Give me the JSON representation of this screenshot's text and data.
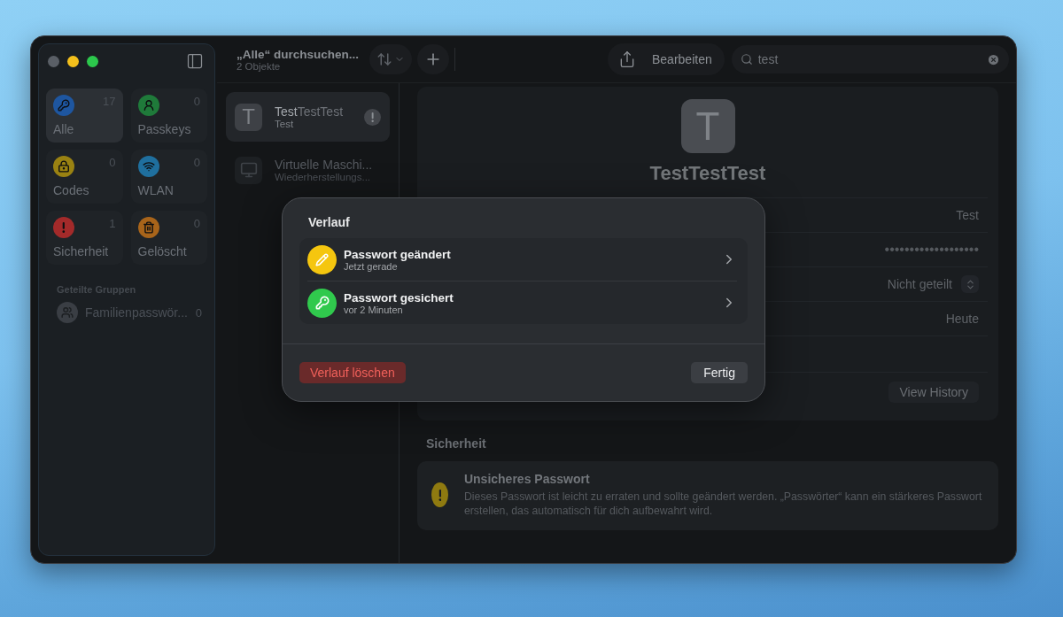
{
  "sidebar": {
    "categories": [
      {
        "label": "Alle",
        "count": "17",
        "kind": "key",
        "color": "#1e56a0",
        "selected": true
      },
      {
        "label": "Passkeys",
        "count": "0",
        "kind": "person",
        "color": "#1f7a3a",
        "selected": false
      },
      {
        "label": "Codes",
        "count": "0",
        "kind": "lock",
        "color": "#9a8212",
        "selected": false
      },
      {
        "label": "WLAN",
        "count": "0",
        "kind": "wifi",
        "color": "#1f6f9e",
        "selected": false
      },
      {
        "label": "Sicherheit",
        "count": "1",
        "kind": "alert",
        "color": "#a32a2a",
        "selected": false
      },
      {
        "label": "Gelöscht",
        "count": "0",
        "kind": "trash",
        "color": "#a8641a",
        "selected": false
      }
    ],
    "section_title": "Geteilte Gruppen",
    "groups": [
      {
        "label": "Familienpasswör...",
        "count": "0"
      }
    ]
  },
  "list": {
    "title": "„Alle“ durchsuchen...",
    "subtitle": "2 Objekte",
    "items": [
      {
        "title": "**Test**TestTest",
        "subtitle": "Test",
        "kind": "letter",
        "letter": "T",
        "warning": true,
        "selected": true
      },
      {
        "title": "Virtuelle Maschi...",
        "subtitle": "Wiederherstellungs...",
        "kind": "monitor",
        "warning": false,
        "selected": false
      }
    ]
  },
  "toolbar": {
    "edit_button": "Bearbeiten",
    "search": {
      "value": "test"
    }
  },
  "detail": {
    "icon_letter": "T",
    "title": "TestTestTest",
    "fields": [
      {
        "kind": "text",
        "value": "Test"
      },
      {
        "kind": "password",
        "value": "•••••••••••••••••••"
      },
      {
        "kind": "select",
        "value": "Nicht geteilt"
      },
      {
        "kind": "text",
        "value": "Heute"
      }
    ],
    "history_button": "View History",
    "security": {
      "heading": "Sicherheit",
      "title": "Unsicheres Passwort",
      "text": "Dieses Passwort ist leicht zu erraten und sollte geändert werden. „Passwörter“ kann ein stärkeres Passwort erstellen, das automatisch für dich aufbewahrt wird."
    }
  },
  "dialog": {
    "title": "Verlauf",
    "entries": [
      {
        "title": "Passwort geändert",
        "time": "Jetzt gerade",
        "kind": "edit",
        "color": "#f5c60f"
      },
      {
        "title": "Passwort gesichert",
        "time": "vor 2 Minuten",
        "kind": "key",
        "color": "#30c94d"
      }
    ],
    "delete_button": "Verlauf löschen",
    "done_button": "Fertig"
  }
}
